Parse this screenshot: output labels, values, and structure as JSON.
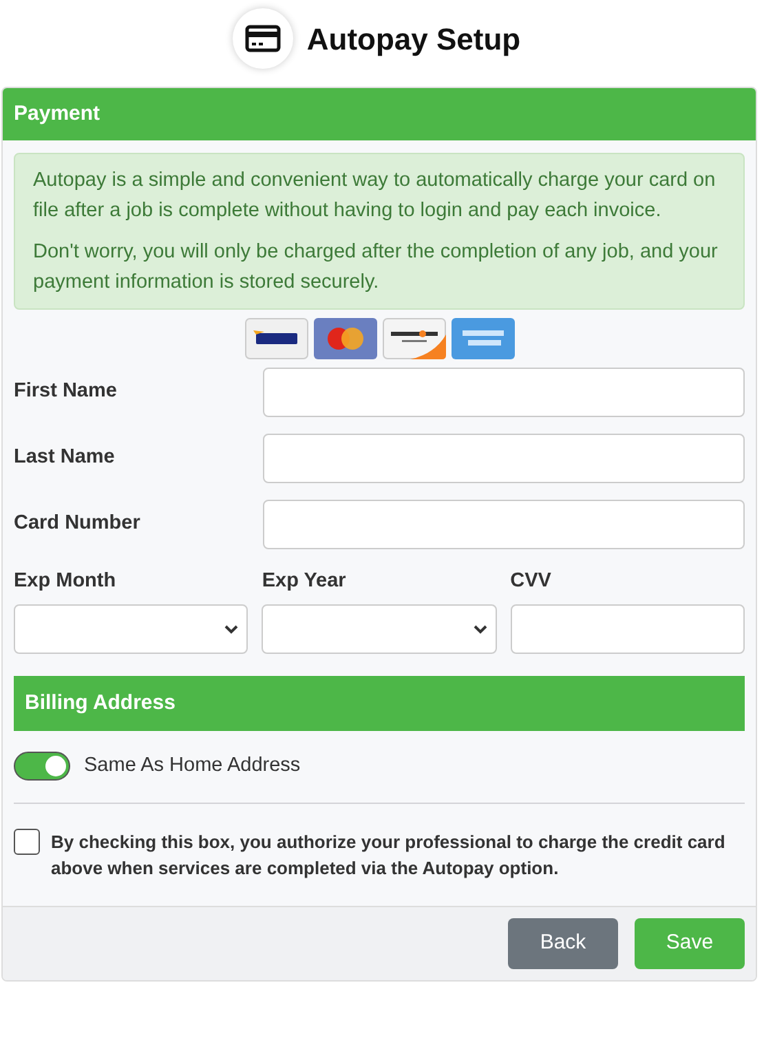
{
  "title": "Autopay Setup",
  "payment": {
    "heading": "Payment",
    "info": [
      "Autopay is a simple and convenient way to automatically charge your card on file after a job is complete without having to login and pay each invoice.",
      "Don't worry, you will only be charged after the completion of any job, and your payment information is stored securely."
    ],
    "fields": [
      {
        "label": "First Name"
      },
      {
        "label": "Last Name"
      },
      {
        "label": "Card Number"
      }
    ],
    "expiry": [
      {
        "label": "Exp Month",
        "kind": "select"
      },
      {
        "label": "Exp Year",
        "kind": "select"
      },
      {
        "label": "CVV",
        "kind": "input"
      }
    ]
  },
  "billing": {
    "heading": "Billing Address",
    "toggle": {
      "label": "Same As Home Address",
      "on": true
    }
  },
  "consent": {
    "label": "By checking this box, you authorize your professional to charge the credit card above when services are completed via the Autopay option.",
    "checked": false
  },
  "buttons": [
    {
      "label": "Back",
      "kind": "secondary"
    },
    {
      "label": "Save",
      "kind": "primary"
    }
  ]
}
